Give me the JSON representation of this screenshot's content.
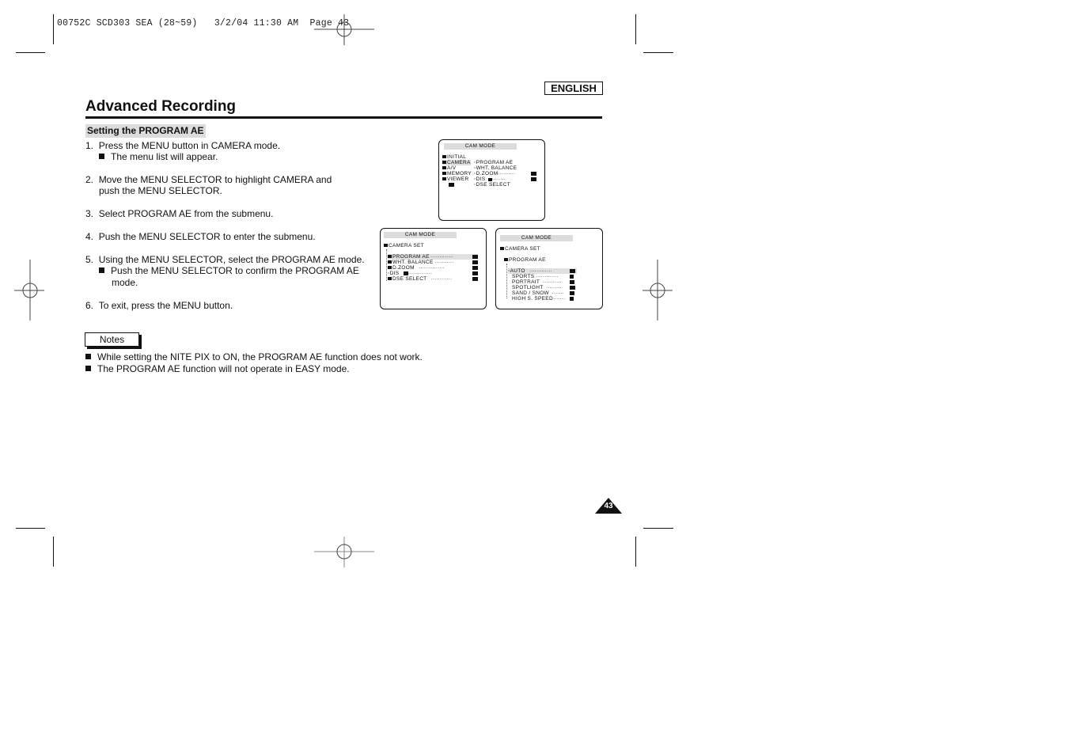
{
  "print_slug": "00752C SCD303 SEA (28~59)   3/2/04 11:30 AM  Page 43",
  "language_badge": "ENGLISH",
  "page_title": "Advanced Recording",
  "section_title": "Setting the PROGRAM AE",
  "steps": [
    {
      "num": "1.",
      "text": "Press the MENU button in CAMERA mode.",
      "sub": "The menu list will appear."
    },
    {
      "num": "2.",
      "text": "Move the MENU SELECTOR to highlight CAMERA and",
      "cont": "push the MENU SELECTOR."
    },
    {
      "num": "3.",
      "text": "Select PROGRAM AE from the submenu."
    },
    {
      "num": "4.",
      "text": "Push the MENU SELECTOR to enter the submenu."
    },
    {
      "num": "5.",
      "text": "Using the MENU SELECTOR, select the PROGRAM AE mode.",
      "sub": "Push the MENU SELECTOR to confirm the PROGRAM AE",
      "sub_cont": "mode."
    },
    {
      "num": "6.",
      "text": "To exit, press the MENU button."
    }
  ],
  "osd_screens": [
    {
      "header": "CAM  MODE",
      "left_menu": [
        "INITIAL",
        "CAMERA",
        "A/V",
        "MEMORY",
        "VIEWER"
      ],
      "right_menu": [
        "PROGRAM AE",
        "WHT. BALANCE",
        "D.ZOOM",
        "DIS",
        "DSE SELECT"
      ]
    },
    {
      "header": "CAM  MODE",
      "parent": "CAMERA SET",
      "items": [
        "PROGRAM AE",
        "WHT. BALANCE",
        "D.ZOOM",
        "DIS",
        "DSE SELECT"
      ]
    },
    {
      "header": "CAM  MODE",
      "parent": "CAMERA SET",
      "sub_parent": "PROGRAM AE",
      "items": [
        "AUTO",
        "SPORTS",
        "PORTRAIT",
        "SPOTLIGHT",
        "SAND / SNOW",
        "HIGH S. SPEED"
      ]
    }
  ],
  "notes_label": "Notes",
  "notes": [
    "While setting the NITE PIX to ON, the PROGRAM AE function does not work.",
    "The PROGRAM AE function will not operate in EASY mode."
  ],
  "page_number": "43"
}
